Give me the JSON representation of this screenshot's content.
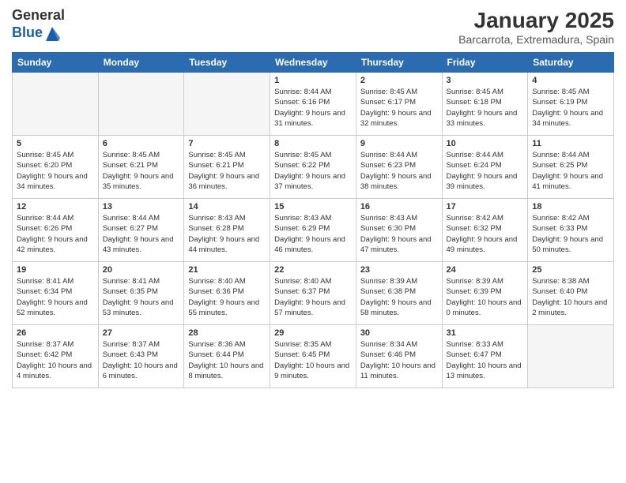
{
  "logo": {
    "general": "General",
    "blue": "Blue"
  },
  "title": "January 2025",
  "subtitle": "Barcarrota, Extremadura, Spain",
  "days_of_week": [
    "Sunday",
    "Monday",
    "Tuesday",
    "Wednesday",
    "Thursday",
    "Friday",
    "Saturday"
  ],
  "weeks": [
    [
      {
        "day": "",
        "info": "",
        "empty": true
      },
      {
        "day": "",
        "info": "",
        "empty": true
      },
      {
        "day": "",
        "info": "",
        "empty": true
      },
      {
        "day": "1",
        "sunrise": "8:44 AM",
        "sunset": "6:16 PM",
        "daylight": "9 hours and 31 minutes."
      },
      {
        "day": "2",
        "sunrise": "8:45 AM",
        "sunset": "6:17 PM",
        "daylight": "9 hours and 32 minutes."
      },
      {
        "day": "3",
        "sunrise": "8:45 AM",
        "sunset": "6:18 PM",
        "daylight": "9 hours and 33 minutes."
      },
      {
        "day": "4",
        "sunrise": "8:45 AM",
        "sunset": "6:19 PM",
        "daylight": "9 hours and 34 minutes."
      }
    ],
    [
      {
        "day": "5",
        "sunrise": "8:45 AM",
        "sunset": "6:20 PM",
        "daylight": "9 hours and 34 minutes."
      },
      {
        "day": "6",
        "sunrise": "8:45 AM",
        "sunset": "6:21 PM",
        "daylight": "9 hours and 35 minutes."
      },
      {
        "day": "7",
        "sunrise": "8:45 AM",
        "sunset": "6:21 PM",
        "daylight": "9 hours and 36 minutes."
      },
      {
        "day": "8",
        "sunrise": "8:45 AM",
        "sunset": "6:22 PM",
        "daylight": "9 hours and 37 minutes."
      },
      {
        "day": "9",
        "sunrise": "8:44 AM",
        "sunset": "6:23 PM",
        "daylight": "9 hours and 38 minutes."
      },
      {
        "day": "10",
        "sunrise": "8:44 AM",
        "sunset": "6:24 PM",
        "daylight": "9 hours and 39 minutes."
      },
      {
        "day": "11",
        "sunrise": "8:44 AM",
        "sunset": "6:25 PM",
        "daylight": "9 hours and 41 minutes."
      }
    ],
    [
      {
        "day": "12",
        "sunrise": "8:44 AM",
        "sunset": "6:26 PM",
        "daylight": "9 hours and 42 minutes."
      },
      {
        "day": "13",
        "sunrise": "8:44 AM",
        "sunset": "6:27 PM",
        "daylight": "9 hours and 43 minutes."
      },
      {
        "day": "14",
        "sunrise": "8:43 AM",
        "sunset": "6:28 PM",
        "daylight": "9 hours and 44 minutes."
      },
      {
        "day": "15",
        "sunrise": "8:43 AM",
        "sunset": "6:29 PM",
        "daylight": "9 hours and 46 minutes."
      },
      {
        "day": "16",
        "sunrise": "8:43 AM",
        "sunset": "6:30 PM",
        "daylight": "9 hours and 47 minutes."
      },
      {
        "day": "17",
        "sunrise": "8:42 AM",
        "sunset": "6:32 PM",
        "daylight": "9 hours and 49 minutes."
      },
      {
        "day": "18",
        "sunrise": "8:42 AM",
        "sunset": "6:33 PM",
        "daylight": "9 hours and 50 minutes."
      }
    ],
    [
      {
        "day": "19",
        "sunrise": "8:41 AM",
        "sunset": "6:34 PM",
        "daylight": "9 hours and 52 minutes."
      },
      {
        "day": "20",
        "sunrise": "8:41 AM",
        "sunset": "6:35 PM",
        "daylight": "9 hours and 53 minutes."
      },
      {
        "day": "21",
        "sunrise": "8:40 AM",
        "sunset": "6:36 PM",
        "daylight": "9 hours and 55 minutes."
      },
      {
        "day": "22",
        "sunrise": "8:40 AM",
        "sunset": "6:37 PM",
        "daylight": "9 hours and 57 minutes."
      },
      {
        "day": "23",
        "sunrise": "8:39 AM",
        "sunset": "6:38 PM",
        "daylight": "9 hours and 58 minutes."
      },
      {
        "day": "24",
        "sunrise": "8:39 AM",
        "sunset": "6:39 PM",
        "daylight": "10 hours and 0 minutes."
      },
      {
        "day": "25",
        "sunrise": "8:38 AM",
        "sunset": "6:40 PM",
        "daylight": "10 hours and 2 minutes."
      }
    ],
    [
      {
        "day": "26",
        "sunrise": "8:37 AM",
        "sunset": "6:42 PM",
        "daylight": "10 hours and 4 minutes."
      },
      {
        "day": "27",
        "sunrise": "8:37 AM",
        "sunset": "6:43 PM",
        "daylight": "10 hours and 6 minutes."
      },
      {
        "day": "28",
        "sunrise": "8:36 AM",
        "sunset": "6:44 PM",
        "daylight": "10 hours and 8 minutes."
      },
      {
        "day": "29",
        "sunrise": "8:35 AM",
        "sunset": "6:45 PM",
        "daylight": "10 hours and 9 minutes."
      },
      {
        "day": "30",
        "sunrise": "8:34 AM",
        "sunset": "6:46 PM",
        "daylight": "10 hours and 11 minutes."
      },
      {
        "day": "31",
        "sunrise": "8:33 AM",
        "sunset": "6:47 PM",
        "daylight": "10 hours and 13 minutes."
      },
      {
        "day": "",
        "info": "",
        "empty": true
      }
    ]
  ]
}
